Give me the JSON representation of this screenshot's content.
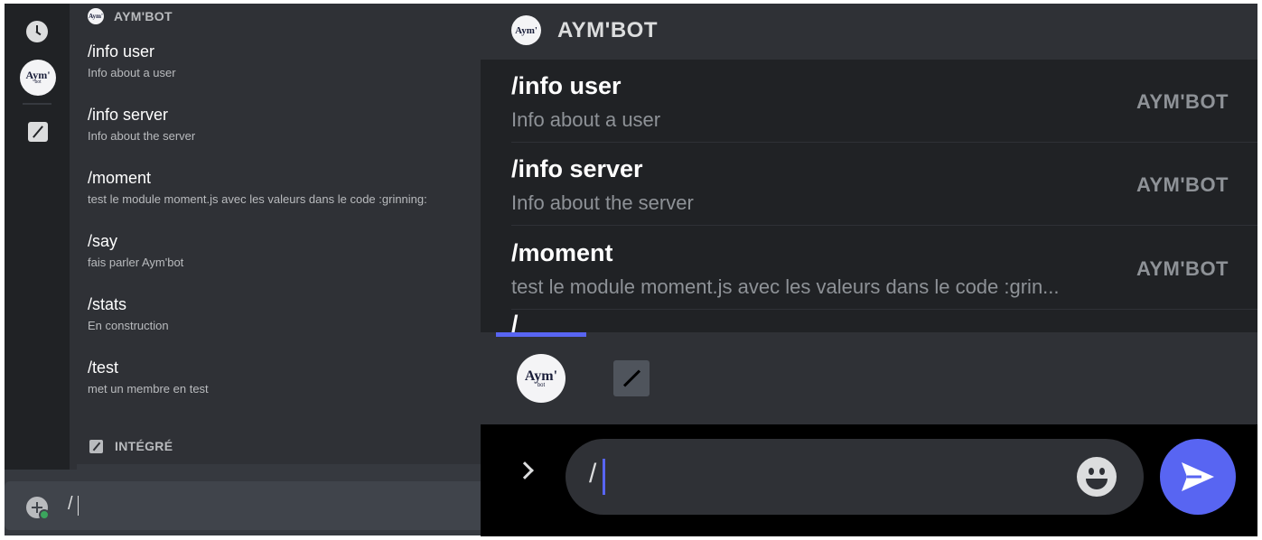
{
  "desktop": {
    "section_title": "AYM'BOT",
    "avatar_text": "Aym'",
    "avatar_subtext": "bot",
    "commands": [
      {
        "name": "/info user",
        "desc": "Info about a user"
      },
      {
        "name": "/info server",
        "desc": "Info about the server"
      },
      {
        "name": "/moment",
        "desc": "test le module moment.js avec les valeurs dans le code :grinning:"
      },
      {
        "name": "/say",
        "desc": "fais parler Aym'bot"
      },
      {
        "name": "/stats",
        "desc": "En construction"
      },
      {
        "name": "/test",
        "desc": "met un membre en test"
      }
    ],
    "builtin_title": "INTÉGRÉ",
    "input_value": "/"
  },
  "mobile": {
    "header_title": "AYM'BOT",
    "avatar_text": "Aym'",
    "avatar_subtext": "bot",
    "commands": [
      {
        "name": "/info user",
        "desc": "Info about a user",
        "source": "AYM'BOT"
      },
      {
        "name": "/info server",
        "desc": "Info about the server",
        "source": "AYM'BOT"
      },
      {
        "name": "/moment",
        "desc": "test le module moment.js avec les valeurs dans le code :grin...",
        "source": "AYM'BOT"
      }
    ],
    "peek_text": "/",
    "input_value": "/"
  },
  "colors": {
    "accent": "#5865f2",
    "online": "#3ba55d"
  }
}
